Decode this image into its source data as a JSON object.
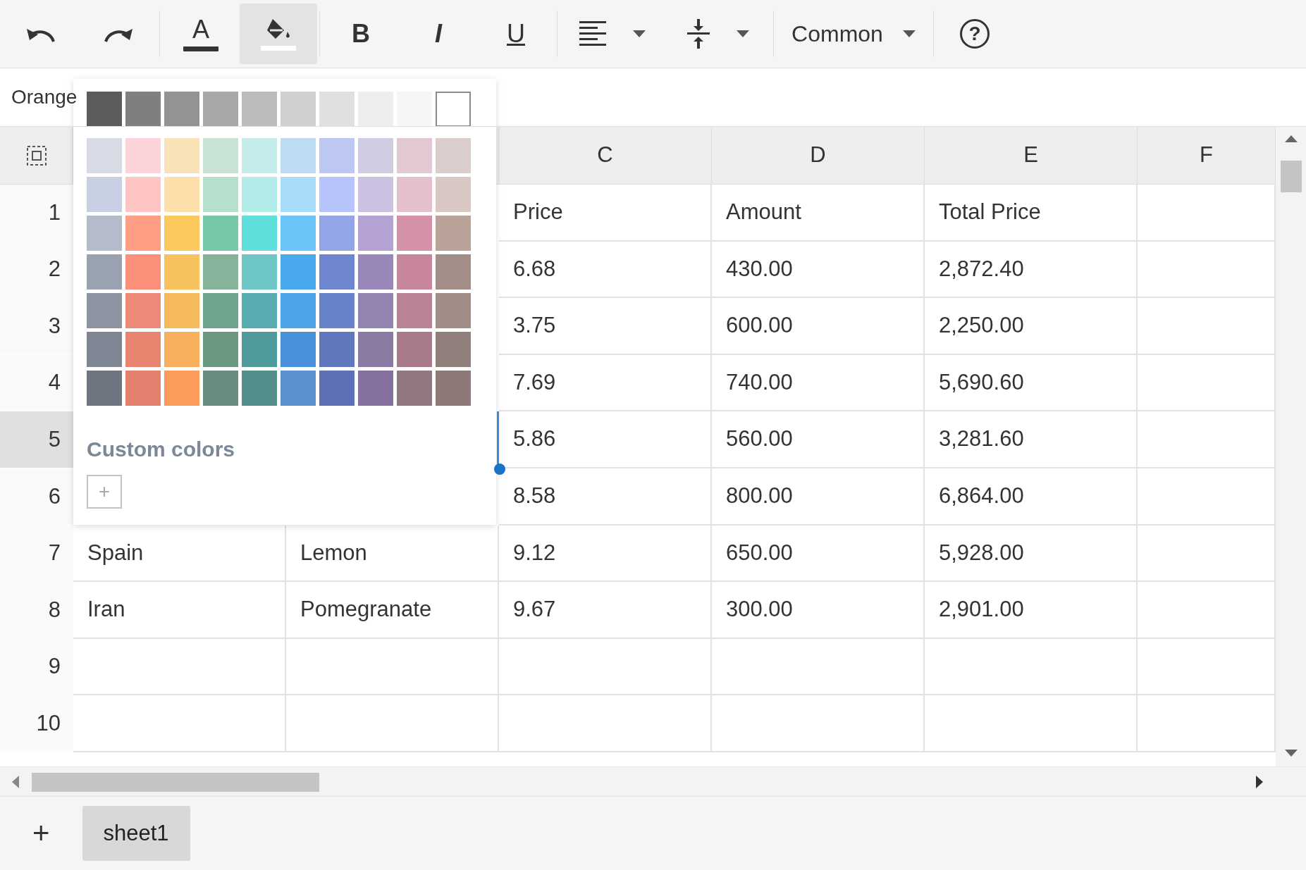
{
  "toolbar": [
    {
      "kind": "undo",
      "pressed": false
    },
    {
      "kind": "redo",
      "pressed": false
    },
    {
      "kind": "separator"
    },
    {
      "kind": "text_color",
      "label": "A",
      "color": "#333333",
      "pressed": false
    },
    {
      "kind": "fill_color",
      "color": "#ffffff",
      "pressed": true
    },
    {
      "kind": "separator"
    },
    {
      "kind": "bold",
      "label": "B",
      "pressed": false
    },
    {
      "kind": "italic",
      "label": "I",
      "pressed": false
    },
    {
      "kind": "underline",
      "label": "U",
      "pressed": false
    },
    {
      "kind": "separator"
    },
    {
      "kind": "align",
      "pressed": false
    },
    {
      "kind": "vertical_align",
      "pressed": false
    },
    {
      "kind": "separator"
    },
    {
      "kind": "select",
      "label": "Common",
      "pressed": false
    },
    {
      "kind": "separator"
    },
    {
      "kind": "help",
      "label": "?",
      "pressed": false
    }
  ],
  "formula_bar": {
    "value": "Orange"
  },
  "columns": [
    "C",
    "D",
    "E",
    "F"
  ],
  "rows": [
    {
      "header": "1",
      "selected": false,
      "cells": [
        {
          "text": "Price",
          "selected": false
        },
        {
          "text": "Amount",
          "selected": false
        },
        {
          "text": "Total Price",
          "selected": false
        }
      ]
    },
    {
      "header": "2",
      "selected": false,
      "cells": [
        {
          "text": "6.68",
          "selected": false
        },
        {
          "text": "430.00",
          "selected": false
        },
        {
          "text": "2,872.40",
          "selected": false
        }
      ]
    },
    {
      "header": "3",
      "selected": false,
      "cells": [
        {
          "text": "3.75",
          "selected": false
        },
        {
          "text": "600.00",
          "selected": false
        },
        {
          "text": "2,250.00",
          "selected": false
        }
      ]
    },
    {
      "header": "4",
      "selected": false,
      "cells": [
        {
          "text": "7.69",
          "selected": false
        },
        {
          "text": "740.00",
          "selected": false
        },
        {
          "text": "5,690.60",
          "selected": false
        }
      ]
    },
    {
      "header": "5",
      "selected": true,
      "cells": [
        {
          "text": "5.86",
          "selected": false
        },
        {
          "text": "560.00",
          "selected": false
        },
        {
          "text": "3,281.60",
          "selected": false
        }
      ]
    },
    {
      "header": "6",
      "selected": false,
      "cells": [
        {
          "text": "8.58",
          "selected": false
        },
        {
          "text": "800.00",
          "selected": false
        },
        {
          "text": "6,864.00",
          "selected": false
        }
      ]
    },
    {
      "header": "7",
      "selected": false,
      "cells": [
        {
          "text": "Spain",
          "selected": false
        },
        {
          "text": "Lemon",
          "selected": false
        },
        {
          "text": "9.12",
          "selected": false
        },
        {
          "text": "650.00",
          "selected": false
        },
        {
          "text": "5,928.00",
          "selected": false
        }
      ]
    },
    {
      "header": "8",
      "selected": false,
      "cells": [
        {
          "text": "Iran",
          "selected": false
        },
        {
          "text": "Pomegranate",
          "selected": false
        },
        {
          "text": "9.67",
          "selected": false
        },
        {
          "text": "300.00",
          "selected": false
        },
        {
          "text": "2,901.00",
          "selected": false
        }
      ]
    },
    {
      "header": "9",
      "selected": false,
      "cells": []
    },
    {
      "header": "10",
      "selected": false,
      "cells": []
    }
  ],
  "color_picker": {
    "swatch_rows": [
      [
        {
          "color": "#5c5c5c"
        },
        {
          "color": "#7f7f7f"
        },
        {
          "color": "#939393"
        },
        {
          "color": "#a8a8a8"
        },
        {
          "color": "#bcbcbc"
        },
        {
          "color": "#d0d0d0"
        },
        {
          "color": "#e0e0e0"
        },
        {
          "color": "#eeeeee"
        },
        {
          "color": "#f6f6f6"
        },
        {
          "color": "#ffffff"
        }
      ],
      [
        {
          "color": "#d6dbe6"
        },
        {
          "color": "#fcd3d9"
        },
        {
          "color": "#f8e3b8"
        },
        {
          "color": "#c8e2d4"
        },
        {
          "color": "#c5ebea"
        },
        {
          "color": "#bcdcf4"
        },
        {
          "color": "#bcc7f2"
        },
        {
          "color": "#cfcbe0"
        },
        {
          "color": "#e3c9d3"
        },
        {
          "color": "#dbcdcb"
        }
      ],
      [
        {
          "color": "#c7cfe2"
        },
        {
          "color": "#ffc4c4"
        },
        {
          "color": "#fcdfaa"
        },
        {
          "color": "#b5e0cc"
        },
        {
          "color": "#b2ebe8"
        },
        {
          "color": "#a9dcfb"
        },
        {
          "color": "#b7c4fb"
        },
        {
          "color": "#cbc2e2"
        },
        {
          "color": "#e6bfcd"
        },
        {
          "color": "#d9c7c3"
        }
      ],
      [
        {
          "color": "#b4bccb"
        },
        {
          "color": "#ff9d85"
        },
        {
          "color": "#fdc85e"
        },
        {
          "color": "#75c9a6"
        },
        {
          "color": "#5edfdb"
        },
        {
          "color": "#6bc3f7"
        },
        {
          "color": "#93a5e7"
        },
        {
          "color": "#b5a2d3"
        },
        {
          "color": "#d492a9"
        },
        {
          "color": "#b9a398"
        }
      ],
      [
        {
          "color": "#98a2b1"
        },
        {
          "color": "#fb8f7a"
        },
        {
          "color": "#f7c25d"
        },
        {
          "color": "#86b49b"
        },
        {
          "color": "#6fc6c7"
        },
        {
          "color": "#4aa8ec"
        },
        {
          "color": "#6f87d0"
        },
        {
          "color": "#9a87ba"
        },
        {
          "color": "#c7859e"
        },
        {
          "color": "#a28e86"
        }
      ],
      [
        {
          "color": "#8c94a2"
        },
        {
          "color": "#ec8a77"
        },
        {
          "color": "#f6b95b"
        },
        {
          "color": "#6fa48c"
        },
        {
          "color": "#57adb0"
        },
        {
          "color": "#4ea4e6"
        },
        {
          "color": "#6782c8"
        },
        {
          "color": "#9283b0"
        },
        {
          "color": "#b98395"
        },
        {
          "color": "#a08e86"
        }
      ],
      [
        {
          "color": "#7f8693"
        },
        {
          "color": "#e88370"
        },
        {
          "color": "#f8af5e"
        },
        {
          "color": "#6a977f"
        },
        {
          "color": "#4f9b9b"
        },
        {
          "color": "#4991d8"
        },
        {
          "color": "#5f78be"
        },
        {
          "color": "#8a7aa3"
        },
        {
          "color": "#a8788b"
        },
        {
          "color": "#8f7e79"
        }
      ],
      [
        {
          "color": "#6e7580"
        },
        {
          "color": "#e37f6d"
        },
        {
          "color": "#fb9c5c"
        },
        {
          "color": "#6a8c80"
        },
        {
          "color": "#558f8c"
        },
        {
          "color": "#5c8fd0"
        },
        {
          "color": "#5e70b8"
        },
        {
          "color": "#8670a0"
        },
        {
          "color": "#917782"
        },
        {
          "color": "#8d7a78"
        }
      ]
    ],
    "custom_label": "Custom colors",
    "add_button": "+"
  },
  "sheet_tabs": {
    "add_button": "+",
    "tabs": [
      {
        "label": "sheet1",
        "selected": true
      }
    ]
  }
}
